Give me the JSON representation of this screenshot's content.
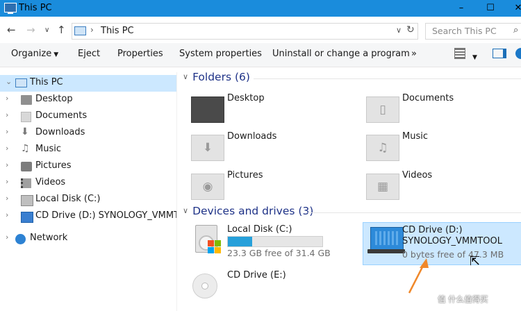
{
  "window": {
    "title": "This PC",
    "controls": [
      "–",
      "☐",
      "✕"
    ]
  },
  "address": {
    "separator": "›",
    "path": "This PC",
    "dropdown": "∨",
    "refresh": "↻"
  },
  "search": {
    "placeholder": "Search This PC",
    "icon": "search-icon"
  },
  "nav_buttons": {
    "back": "←",
    "forward": "→",
    "recent": "∨",
    "up": "↑"
  },
  "commands": {
    "organize": "Organize",
    "eject": "Eject",
    "properties": "Properties",
    "system_properties": "System properties",
    "uninstall": "Uninstall or change a program",
    "more": "»"
  },
  "tree": {
    "this_pc": "This PC",
    "items": [
      {
        "label": "Desktop",
        "icon": "desktop-folder-icon"
      },
      {
        "label": "Documents",
        "icon": "documents-folder-icon"
      },
      {
        "label": "Downloads",
        "icon": "downloads-icon"
      },
      {
        "label": "Music",
        "icon": "music-icon"
      },
      {
        "label": "Pictures",
        "icon": "pictures-icon"
      },
      {
        "label": "Videos",
        "icon": "videos-icon"
      },
      {
        "label": "Local Disk (C:)",
        "icon": "local-disk-icon"
      },
      {
        "label": "CD Drive (D:) SYNOLOGY_VMMTOOL",
        "icon": "cd-drive-icon"
      }
    ],
    "network": "Network"
  },
  "folders": {
    "header": "Folders (6)",
    "items": [
      "Desktop",
      "Documents",
      "Downloads",
      "Music",
      "Pictures",
      "Videos"
    ]
  },
  "devices": {
    "header": "Devices and drives (3)",
    "local_disk": {
      "name": "Local Disk (C:)",
      "free": "23.3 GB free of 31.4 GB",
      "used_fraction": 0.26
    },
    "cd_d": {
      "name": "CD Drive (D:)",
      "label": "SYNOLOGY_VMMTOOL",
      "free": "0 bytes free of 47.3 MB"
    },
    "cd_e": {
      "name": "CD Drive (E:)"
    }
  },
  "watermark": "值 什么值得买",
  "colors": {
    "titlebar": "#1a8cdc",
    "selection": "#cce8ff",
    "header_text": "#1e3287",
    "arrow": "#f0882a",
    "bar_fill": "#26a0da"
  }
}
